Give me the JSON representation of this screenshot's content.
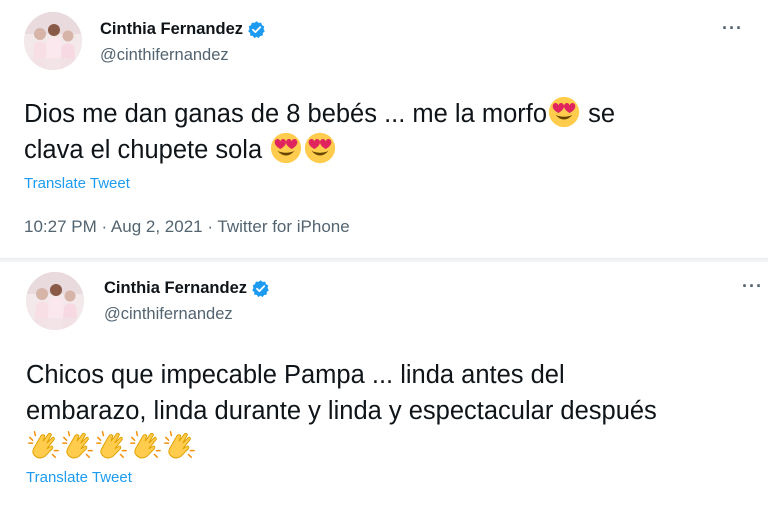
{
  "tweets": [
    {
      "author_name": "Cinthia Fernandez",
      "handle": "@cinthifernandez",
      "text_line1": "Dios me dan ganas de 8 bebés ... me la morfo",
      "text_line1_end": " se",
      "text_line2": "clava el chupete sola",
      "translate_label": "Translate Tweet",
      "meta": "10:27 PM · Aug 2, 2021 · Twitter for iPhone",
      "emojis": [
        "heart-eyes",
        "heart-eyes",
        "heart-eyes"
      ]
    },
    {
      "author_name": "Cinthia Fernandez",
      "handle": "@cinthifernandez",
      "text_line1": "Chicos que impecable Pampa ... linda antes del",
      "text_line2": "embarazo, linda durante y linda y espectacular después",
      "translate_label": "Translate Tweet",
      "emojis": [
        "clapping-hands",
        "clapping-hands",
        "clapping-hands",
        "clapping-hands",
        "clapping-hands"
      ]
    }
  ],
  "more_label": "···",
  "colors": {
    "link": "#1d9bf0",
    "verified": "#1d9bf0",
    "secondary_text": "#536471"
  }
}
